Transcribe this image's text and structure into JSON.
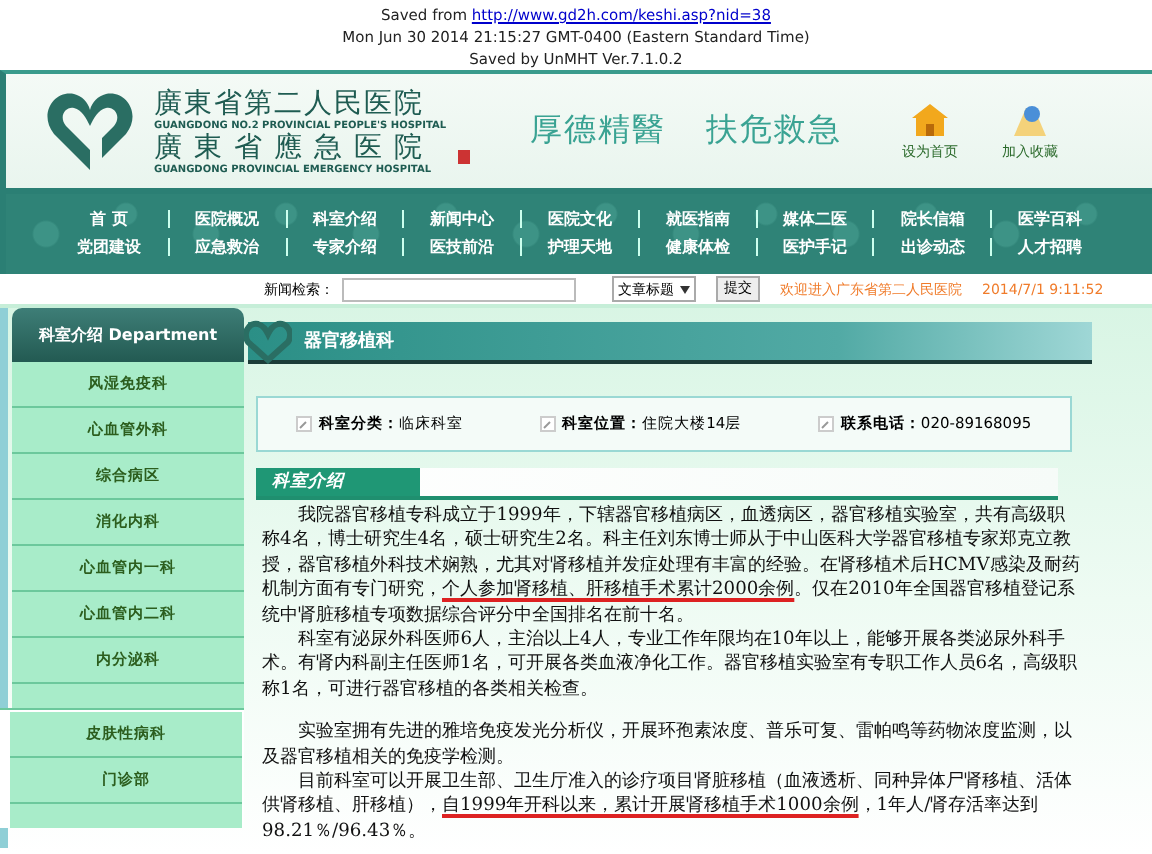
{
  "saved_header": {
    "saved_from_label": "Saved from",
    "url": "http://www.gd2h.com/keshi.asp?nid=38",
    "date": "Mon Jun 30 2014 21:15:27 GMT-0400 (Eastern Standard Time)",
    "saved_by": "Saved by UnMHT Ver.7.1.0.2"
  },
  "banner": {
    "name_cn": "廣東省第二人民医院",
    "name_en": "GUANGDONG NO.2 PROVINCIAL PEOPLE'S HOSPITAL",
    "name2_cn": "廣東省應急医院",
    "name2_en": "GUANGDONG PROVINCIAL EMERGENCY HOSPITAL",
    "slogans": [
      "厚德精醫",
      "扶危救急"
    ],
    "actions": [
      {
        "kind": "home",
        "label": "设为首页"
      },
      {
        "kind": "favorite",
        "label": "加入收藏"
      }
    ]
  },
  "nav": {
    "rows": [
      [
        "首 页",
        "医院概况",
        "科室介绍",
        "新闻中心",
        "医院文化",
        "就医指南",
        "媒体二医",
        "院长信箱",
        "医学百科"
      ],
      [
        "党团建设",
        "应急救治",
        "专家介绍",
        "医技前沿",
        "护理天地",
        "健康体检",
        "医护手记",
        "出诊动态",
        "人才招聘"
      ]
    ]
  },
  "search": {
    "label": "新闻检索：",
    "select_value": "文章标题",
    "submit": "提交",
    "welcome": "欢迎进入广东省第二人民医院",
    "datetime": "2014/7/1 9:11:52"
  },
  "sidebar": {
    "title": "科室介绍 Department",
    "items": [
      "风湿免疫科",
      "心血管外科",
      "综合病区",
      "消化内科",
      "心血管内一科",
      "心血管内二科",
      "内分泌科"
    ]
  },
  "sidebar_panel": {
    "items": [
      "皮肤性病科",
      "门诊部"
    ]
  },
  "content": {
    "title": "器官移植科",
    "info": [
      {
        "label": "科室分类：",
        "value": "临床科室"
      },
      {
        "label": "科室位置：",
        "value": "住院大楼14层"
      },
      {
        "label": "联系电话：",
        "value": "020-89168095"
      }
    ],
    "section_tab": "科室介绍",
    "paragraphs": [
      [
        {
          "text": "我院器官移植专科成立于1999年，下辖器官移植病区，血透病区，器官移植实验室，共有高级职称4名，博士研究生4名，硕士研究生2名。科主任刘东博士师从于中山医科大学器官移植专家郑克立教授，器官移植外科技术娴熟，尤其对肾移植并发症处理有丰富的经验。在肾移植术后HCMV感染及耐药机制方面有专门研究，",
          "underlined": false
        },
        {
          "text": "个人参加肾移植、肝移植手术累计2000余例",
          "underlined": true
        },
        {
          "text": "。仅在2010年全国器官移植登记系统中肾脏移植专项数据综合评分中全国排名在前十名。",
          "underlined": false
        }
      ],
      [
        {
          "text": "科室有泌尿外科医师6人，主治以上4人，专业工作年限均在10年以上，能够开展各类泌尿外科手术。有肾内科副主任医师1名，可开展各类血液净化工作。器官移植实验室有专职工作人员6名，高级职称1名，可进行器官移植的各类相关检查。",
          "underlined": false
        }
      ],
      [
        {
          "text": "实验室拥有先进的雅培免疫发光分析仪，开展环孢素浓度、普乐可复、雷帕鸣等药物浓度监测，以及器官移植相关的免疫学检测。",
          "underlined": false
        }
      ],
      [
        {
          "text": "目前科室可以开展卫生部、卫生厅准入的诊疗项目肾脏移植（血液透析、同种异体尸肾移植、活体供肾移植、肝移植），",
          "underlined": false
        },
        {
          "text": "自1999年开科以来，累计开展肾移植手术1000余例",
          "underlined": true
        },
        {
          "text": "，1年人/肾存活率达到98.21％/96.43％。",
          "underlined": false
        }
      ]
    ]
  }
}
